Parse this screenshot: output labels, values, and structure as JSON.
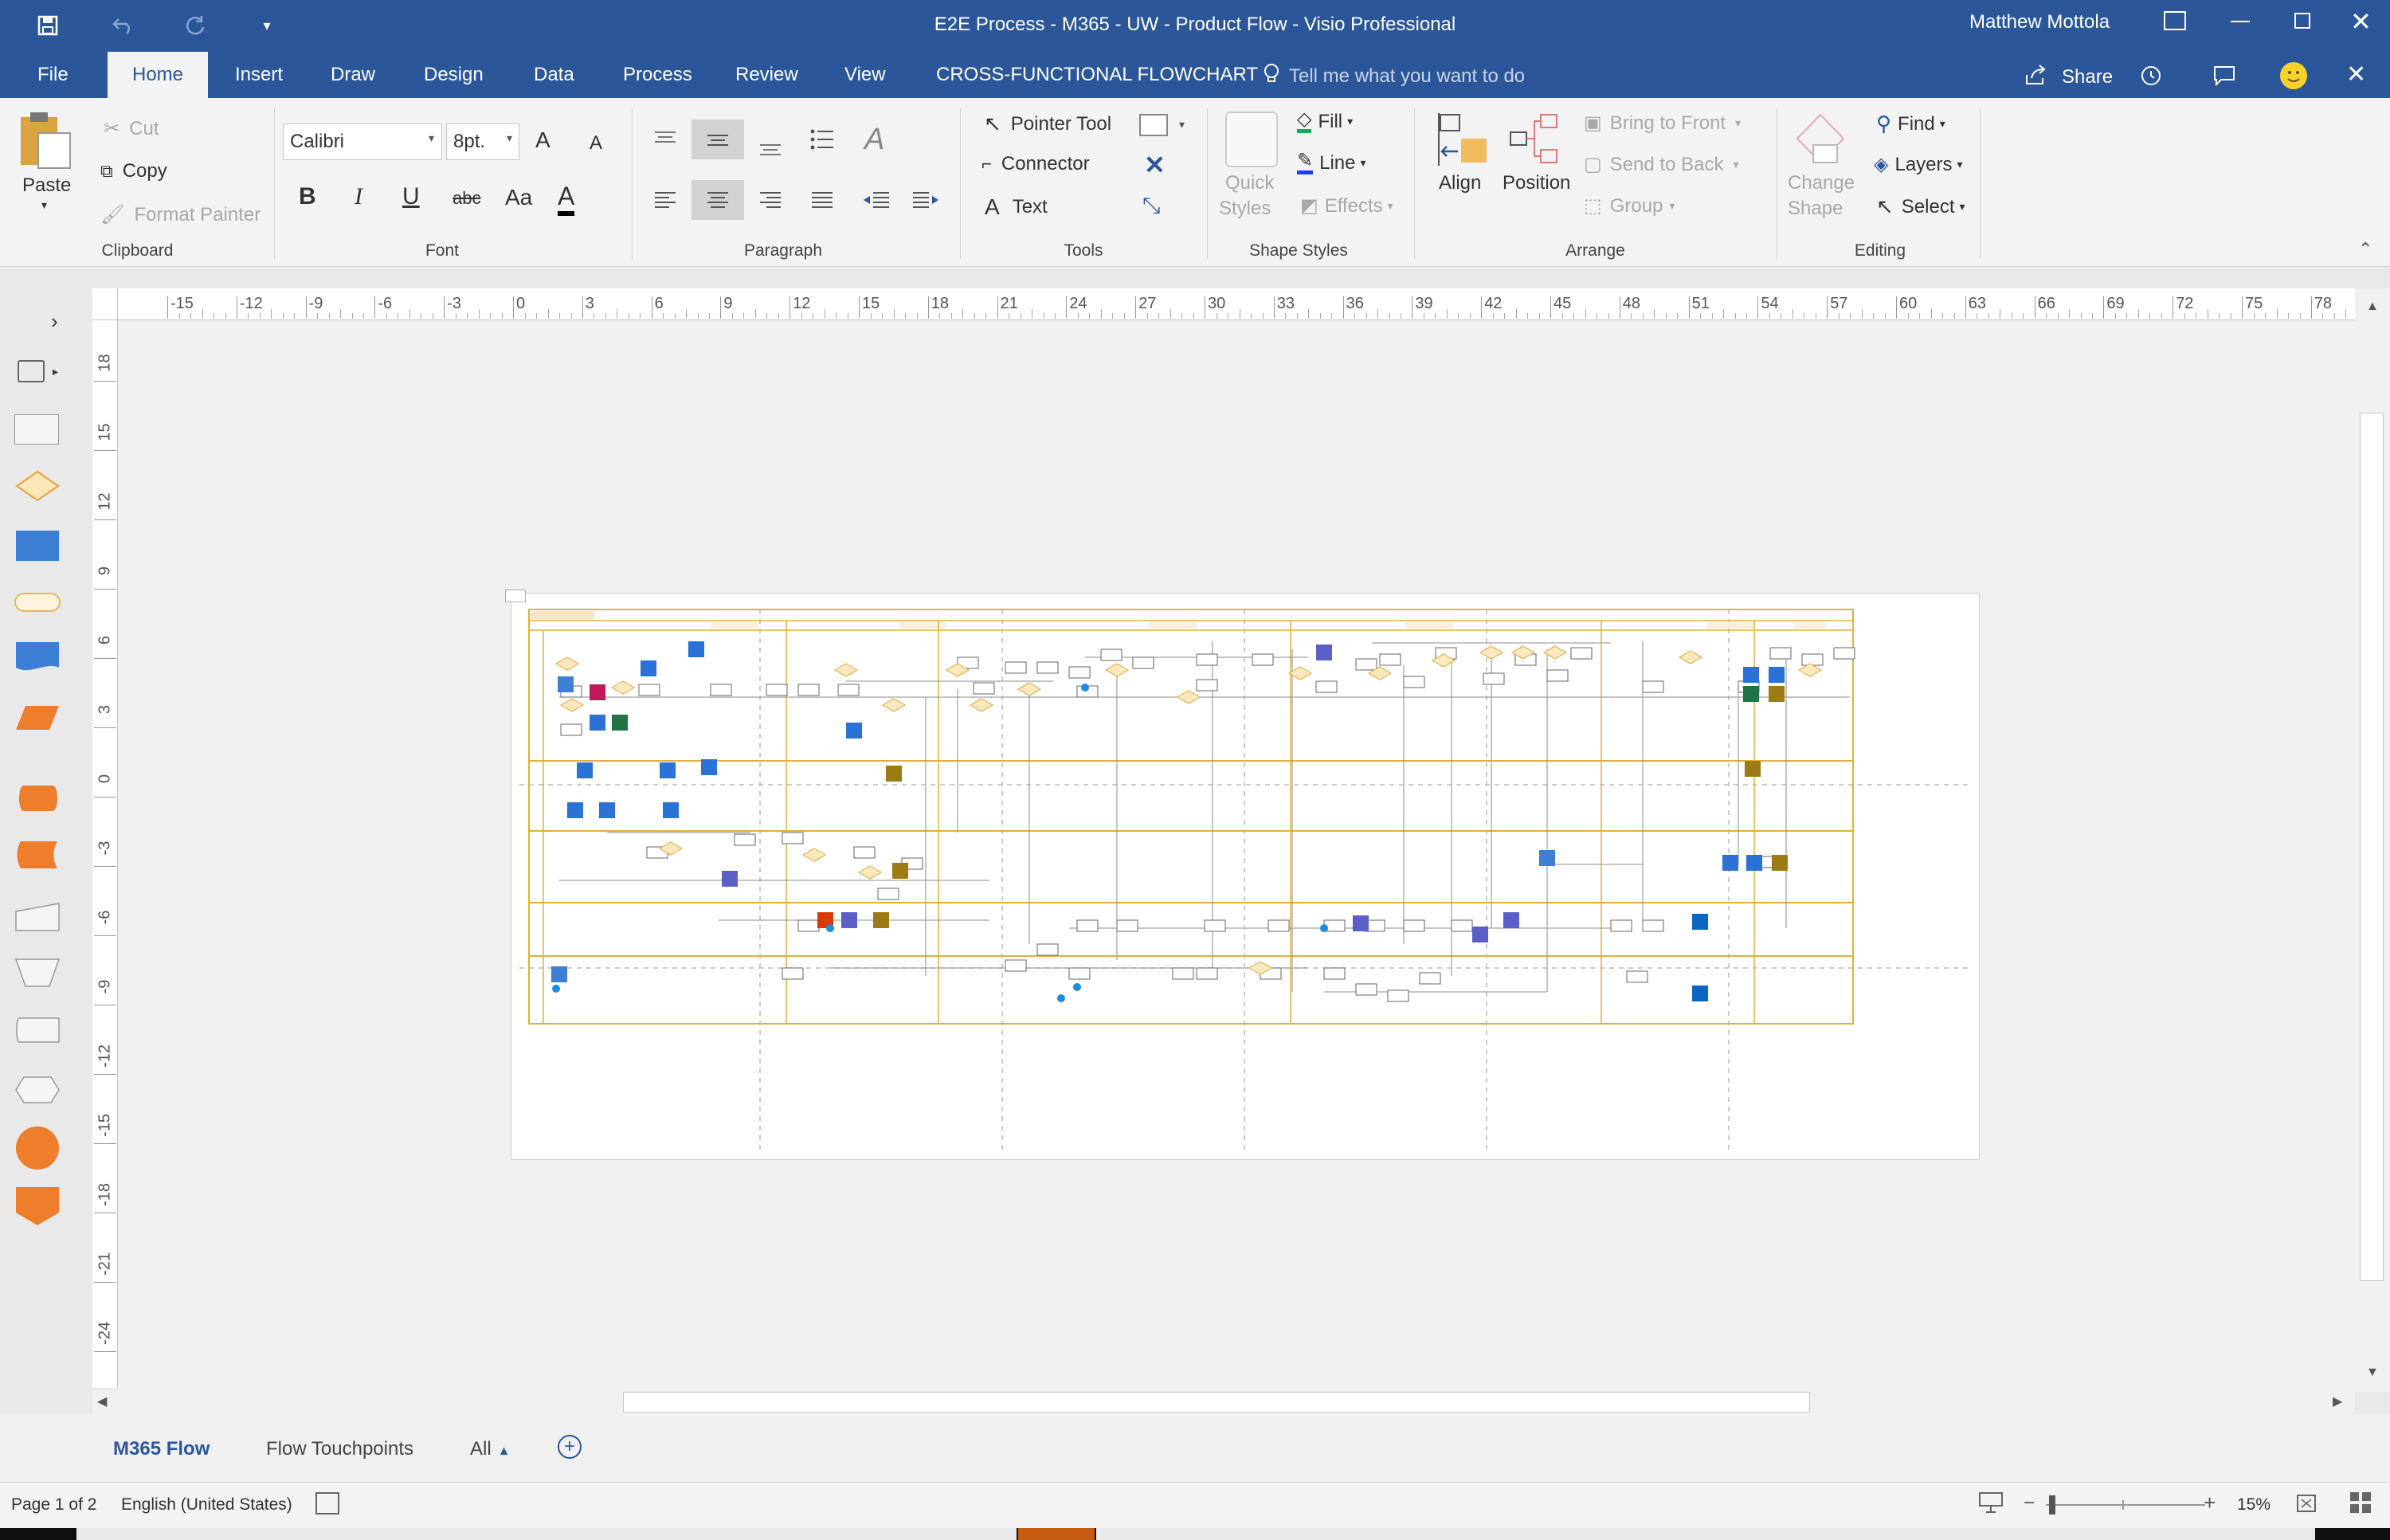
{
  "window": {
    "title": "E2E Process - M365 - UW - Product Flow  -  Visio Professional",
    "user": "Matthew Mottola",
    "accent": "#2b579a"
  },
  "quick_access": [
    {
      "icon": "save-icon"
    },
    {
      "icon": "undo-icon"
    },
    {
      "icon": "redo-icon"
    },
    {
      "icon": "customize-qat-icon"
    }
  ],
  "tabs": [
    "File",
    "Home",
    "Insert",
    "Draw",
    "Design",
    "Data",
    "Process",
    "Review",
    "View",
    "CROSS-FUNCTIONAL FLOWCHART"
  ],
  "active_tab": "Home",
  "tell_me": "Tell me what you want to do",
  "share_label": "Share",
  "ribbon": {
    "clipboard": {
      "paste": "Paste",
      "cut": "Cut",
      "copy": "Copy",
      "format_painter": "Format Painter",
      "label": "Clipboard"
    },
    "font": {
      "family": "Calibri",
      "size": "8pt.",
      "bold": "B",
      "italic": "I",
      "underline": "U",
      "strike": "abc",
      "case": "Aa",
      "color": "A",
      "grow": "A",
      "shrink": "A",
      "label": "Font"
    },
    "paragraph": {
      "label": "Paragraph"
    },
    "tools": {
      "pointer": "Pointer Tool",
      "connector": "Connector",
      "text": "Text",
      "label": "Tools"
    },
    "shape_styles": {
      "quick_styles_1": "Quick",
      "quick_styles_2": "Styles",
      "fill": "Fill",
      "line": "Line",
      "effects": "Effects",
      "label": "Shape Styles"
    },
    "arrange": {
      "align": "Align",
      "position": "Position",
      "bring_front": "Bring to Front",
      "send_back": "Send to Back",
      "group": "Group",
      "label": "Arrange"
    },
    "change_shape_1": "Change",
    "change_shape_2": "Shape",
    "editing": {
      "find": "Find",
      "layers": "Layers",
      "select": "Select",
      "label": "Editing"
    }
  },
  "ruler": {
    "h_ticks": [
      "-15",
      "-12",
      "-9",
      "-6",
      "-3",
      "0",
      "3",
      "6",
      "9",
      "12",
      "15",
      "18",
      "21",
      "24",
      "27",
      "30",
      "33",
      "36",
      "39",
      "42",
      "45",
      "48",
      "51",
      "54",
      "57",
      "60",
      "63",
      "66",
      "69",
      "72",
      "75",
      "78"
    ],
    "v_ticks": [
      "18",
      "15",
      "12",
      "9",
      "6",
      "3",
      "0",
      "-3",
      "-6",
      "-9",
      "-12",
      "-15",
      "-18",
      "-21",
      "-24"
    ]
  },
  "sheets": {
    "tabs": [
      "M365 Flow",
      "Flow Touchpoints"
    ],
    "active": "M365 Flow",
    "all_label": "All"
  },
  "status": {
    "page": "Page 1 of 2",
    "language": "English (United States)",
    "zoom": "15%"
  },
  "diagram": {
    "lane_color": "#e0b13a",
    "app_colors": {
      "outlook": "#2a72d5",
      "teams": "#5b5fc7",
      "linkedin": "#0a66c2",
      "excel": "#217346",
      "powerbi": "#9c7a14",
      "office": "#d83b01"
    }
  }
}
